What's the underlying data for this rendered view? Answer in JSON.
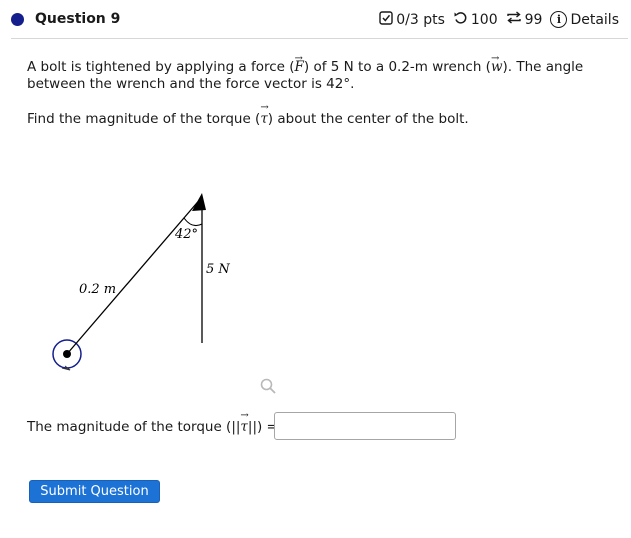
{
  "header": {
    "question_title": "Question 9",
    "points": "0/3 pts",
    "attempts_icon": "undo-icon",
    "attempts_remaining": "100",
    "retries_icon": "repeat-icon",
    "retries": "99",
    "details_label": "Details",
    "status_dot_color": "#141e8c"
  },
  "problem": {
    "line1_a": "A bolt is tightened by applying a force (",
    "force_symbol": "F",
    "line1_b": ") of 5 N to a 0.2-m wrench (",
    "wrench_symbol": "w",
    "line1_c": "). The angle",
    "line2": "between the wrench and the force vector is 42°.",
    "prompt_a": "Find the magnitude of the torque (",
    "torque_symbol": "τ",
    "prompt_b": ") about the center of the bolt."
  },
  "diagram": {
    "angle_label": "42°",
    "force_label": "5 N",
    "wrench_label": "0.2 m"
  },
  "answer": {
    "label_a": "The magnitude of the torque (||",
    "torque_symbol": "τ",
    "label_b": "||) =",
    "value": "",
    "placeholder": ""
  },
  "submit_label": "Submit Question",
  "accent_color": "#1d72d6"
}
